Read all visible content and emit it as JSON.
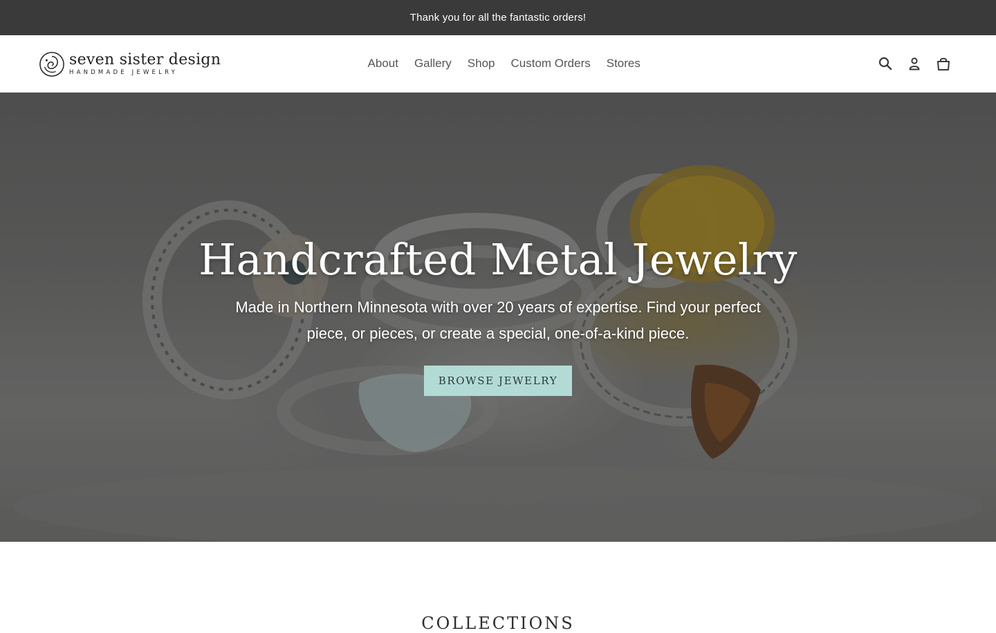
{
  "announcement": {
    "text": "Thank you for all the fantastic orders!"
  },
  "header": {
    "logo": {
      "name": "seven sister design",
      "subtitle": "HANDMADE JEWELRY"
    },
    "nav": [
      "About",
      "Gallery",
      "Shop",
      "Custom Orders",
      "Stores"
    ],
    "icons": [
      "search-icon",
      "account-icon",
      "cart-icon"
    ]
  },
  "hero": {
    "title": "Handcrafted Metal Jewelry",
    "subtitle": "Made in Northern Minnesota with over 20 years of expertise. Find your perfect piece, or pieces, or create a special, one-of-a-kind piece.",
    "button_label": "BROWSE JEWELRY",
    "button_color": "#b3dbd5"
  },
  "collections": {
    "title": "COLLECTIONS"
  },
  "colors": {
    "announcement_bg": "#3a3a3a",
    "nav_text": "#555555",
    "accent": "#b3dbd5"
  }
}
